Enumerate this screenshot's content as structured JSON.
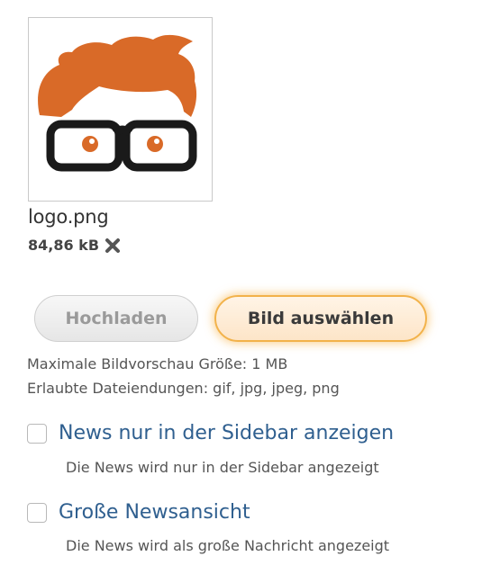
{
  "upload": {
    "file_name": "logo.png",
    "file_size": "84,86 kB",
    "remove_icon": "close-icon",
    "upload_label": "Hochladen",
    "choose_label": "Bild auswählen",
    "max_size_text": "Maximale Bildvorschau Größe: 1 MB",
    "allowed_ext_text": "Erlaubte Dateiendungen: gif, jpg, jpeg, png"
  },
  "options": [
    {
      "label": "News nur in der Sidebar anzeigen",
      "description": "Die News wird nur in der Sidebar angezeigt",
      "checked": false
    },
    {
      "label": "Große Newsansicht",
      "description": "Die News wird als große Nachricht angezeigt",
      "checked": false
    }
  ],
  "colors": {
    "logo_hair": "#d96a28",
    "link_blue": "#2f5f8f",
    "accent_orange": "#f2b24a"
  }
}
